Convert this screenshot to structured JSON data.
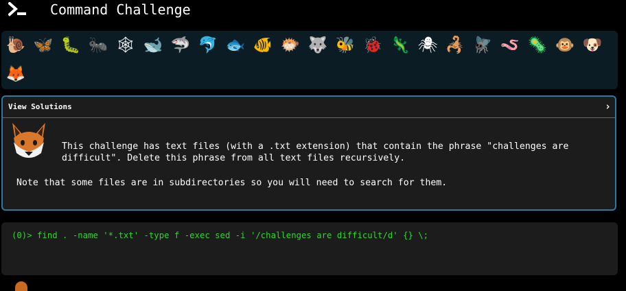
{
  "header": {
    "title": "Command Challenge",
    "logo_icon": "terminal-prompt-icon"
  },
  "animals": [
    {
      "name": "snail",
      "glyph": "🐌"
    },
    {
      "name": "butterfly",
      "glyph": "🦋"
    },
    {
      "name": "caterpillar",
      "glyph": "🐛"
    },
    {
      "name": "ant",
      "glyph": "🐜"
    },
    {
      "name": "spider-web",
      "glyph": "🕸"
    },
    {
      "name": "whale",
      "glyph": "🐋"
    },
    {
      "name": "shark",
      "glyph": "🦈"
    },
    {
      "name": "dolphin",
      "glyph": "🐬"
    },
    {
      "name": "fish",
      "glyph": "🐟"
    },
    {
      "name": "tropical-fish",
      "glyph": "🐠"
    },
    {
      "name": "blowfish",
      "glyph": "🐡"
    },
    {
      "name": "wolf",
      "glyph": "🐺"
    },
    {
      "name": "bee",
      "glyph": "🐝"
    },
    {
      "name": "ladybug",
      "glyph": "🐞"
    },
    {
      "name": "lizard",
      "glyph": "🦎"
    },
    {
      "name": "spider",
      "glyph": "🕷"
    },
    {
      "name": "scorpion",
      "glyph": "🦂"
    },
    {
      "name": "fly",
      "glyph": "🪰"
    },
    {
      "name": "worm",
      "glyph": "🪱"
    },
    {
      "name": "microbe",
      "glyph": "🦠"
    },
    {
      "name": "monkey",
      "glyph": "🐵"
    },
    {
      "name": "dog",
      "glyph": "🐶"
    },
    {
      "name": "fox",
      "glyph": "🦊"
    }
  ],
  "solutions": {
    "label": "View Solutions",
    "chevron": "›",
    "description": "This challenge has text files (with a .txt extension) that contain the phrase \"challenges are difficult\". Delete this phrase from all text files recursively.",
    "note": "Note that some files are in subdirectories so you will need to search for them."
  },
  "terminal": {
    "prompt": "(0)>",
    "command": "find . -name '*.txt' -type f -exec sed -i '/challenges are difficult/d' {} \\;"
  },
  "colors": {
    "background": "#000000",
    "animal_bar": "#0b1c24",
    "panel": "#1c1c1c",
    "accent_border": "#2b7aa3",
    "terminal_text": "#2fd62f"
  }
}
